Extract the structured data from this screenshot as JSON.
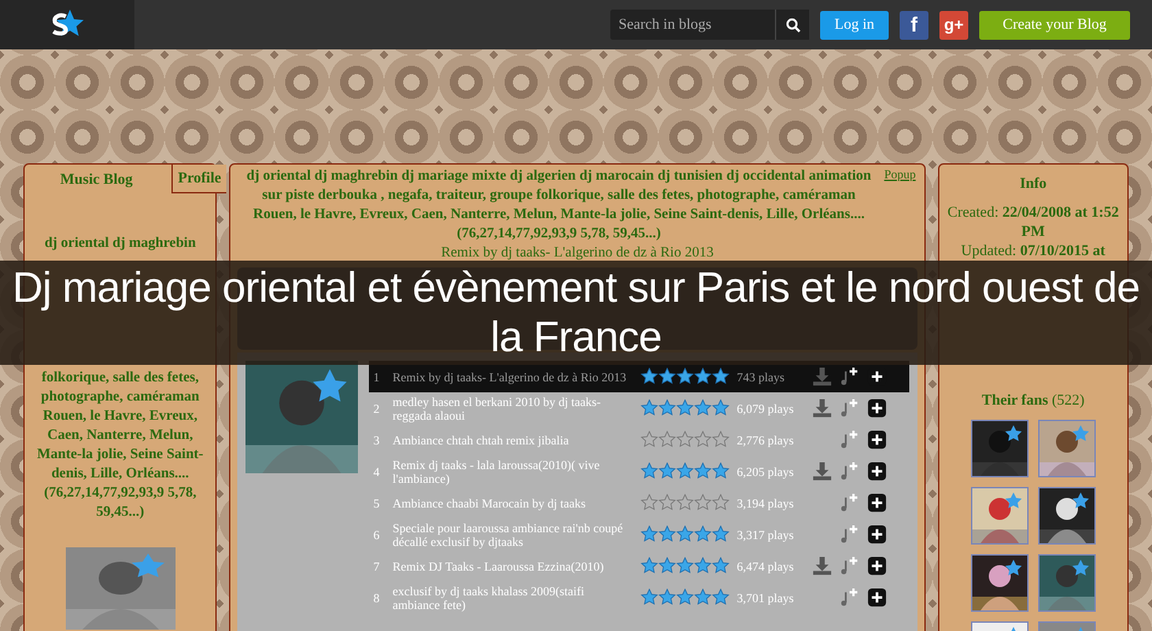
{
  "topbar": {
    "search": {
      "placeholder": "Search in blogs"
    },
    "login": "Log in",
    "facebook": "f",
    "google": "g+",
    "create": "Create your Blog"
  },
  "banner": {
    "title": "Dj mariage oriental et évènement sur Paris et le nord ouest de la France"
  },
  "left": {
    "tabs": [
      {
        "label": "Music Blog",
        "selected": true
      },
      {
        "label": "Profile",
        "selected": false
      }
    ],
    "description_top": "dj oriental dj maghrebin",
    "description_bottom": "folkorique, salle des fetes, photographe, caméraman Rouen, le Havre, Evreux, Caen, Nanterre, Melun, Mante-la jolie, Seine Saint-denis, Lille, Orléans.... (76,27,14,77,92,93,9 5,78, 59,45...)"
  },
  "center": {
    "description": "dj oriental dj maghrebin dj mariage mixte dj algerien dj marocain dj tunisien dj occidental animation sur piste derbouka , negafa, traiteur, groupe folkorique, salle des fetes, photographe, caméraman Rouen, le Havre, Evreux, Caen, Nanterre, Melun, Mante-la jolie, Seine Saint-denis, Lille, Orléans.... (76,27,14,77,92,93,9 5,78, 59,45...)",
    "popup": "Popup",
    "now_playing": "Remix by dj taaks- L'algerino de dz à Rio 2013",
    "tracks": [
      {
        "number": "1",
        "title": "Remix by dj taaks- L'algerino de dz à Rio 2013",
        "stars": 5,
        "plays": "743 plays",
        "downloadable": true,
        "selected": true
      },
      {
        "number": "2",
        "title": "medley hasen el berkani 2010 by dj taaks-reggada alaoui",
        "stars": 5,
        "plays": "6,079 plays",
        "downloadable": true,
        "selected": false
      },
      {
        "number": "3",
        "title": "Ambiance chtah chtah remix jibalia",
        "stars": 0,
        "plays": "2,776 plays",
        "downloadable": false,
        "selected": false
      },
      {
        "number": "4",
        "title": "Remix dj taaks - lala laroussa(2010)( vive l'ambiance)",
        "stars": 5,
        "plays": "6,205 plays",
        "downloadable": true,
        "selected": false
      },
      {
        "number": "5",
        "title": "Ambiance chaabi Marocain by dj taaks",
        "stars": 0,
        "plays": "3,194 plays",
        "downloadable": false,
        "selected": false
      },
      {
        "number": "6",
        "title": "Speciale pour laaroussa ambiance rai'nb coupé décallé exclusif by djtaaks",
        "stars": 5,
        "plays": "3,317 plays",
        "downloadable": false,
        "selected": false
      },
      {
        "number": "7",
        "title": "Remix DJ Taaks - Laaroussa Ezzina(2010)",
        "stars": 5,
        "plays": "6,474 plays",
        "downloadable": true,
        "selected": false
      },
      {
        "number": "8",
        "title": "exclusif by dj taaks khalass 2009(staifi ambiance fete)",
        "stars": 5,
        "plays": "3,701 plays",
        "downloadable": false,
        "selected": false
      }
    ]
  },
  "info": {
    "title": "Info",
    "created_label": "Created:",
    "created": "22/04/2008 at 1:52 PM",
    "updated_label": "Updated:",
    "updated": "07/10/2015 at",
    "fans_title": "Their fans",
    "fans_count": "(522)"
  }
}
